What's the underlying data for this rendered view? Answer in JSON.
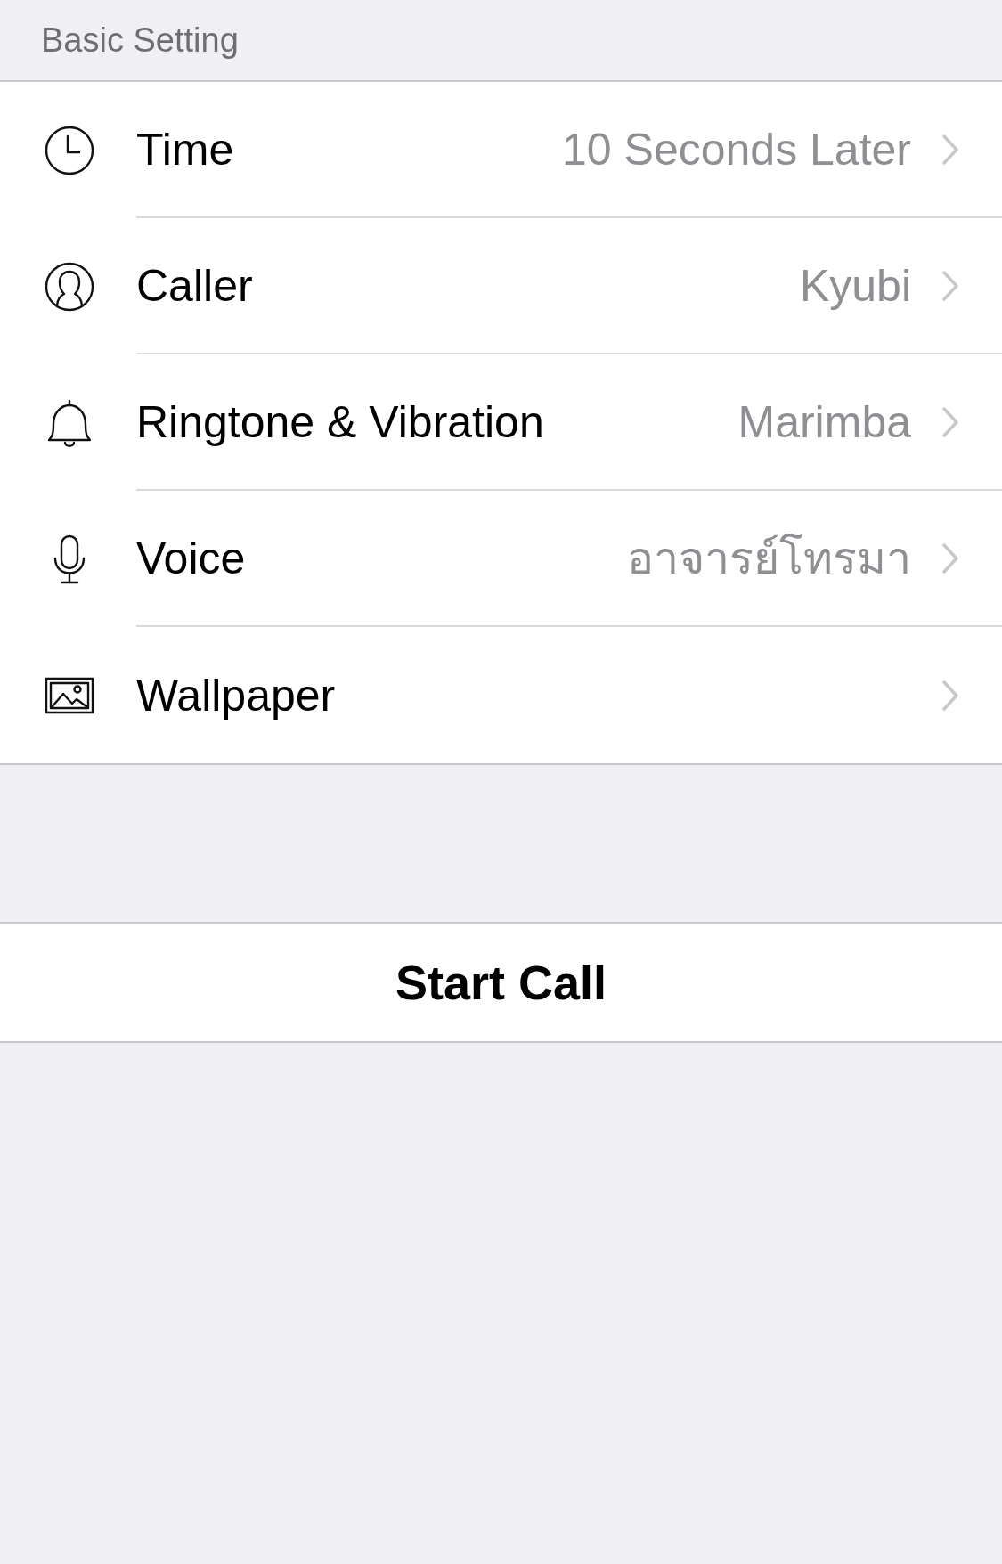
{
  "section_header": "Basic Setting",
  "rows": [
    {
      "kind": "clock",
      "label": "Time",
      "value": "10 Seconds Later"
    },
    {
      "kind": "person",
      "label": "Caller",
      "value": "Kyubi"
    },
    {
      "kind": "bell",
      "label": "Ringtone & Vibration",
      "value": "Marimba"
    },
    {
      "kind": "microphone",
      "label": "Voice",
      "value": "อาจารย์โทรมา"
    },
    {
      "kind": "image",
      "label": "Wallpaper"
    }
  ],
  "button": "Start Call"
}
